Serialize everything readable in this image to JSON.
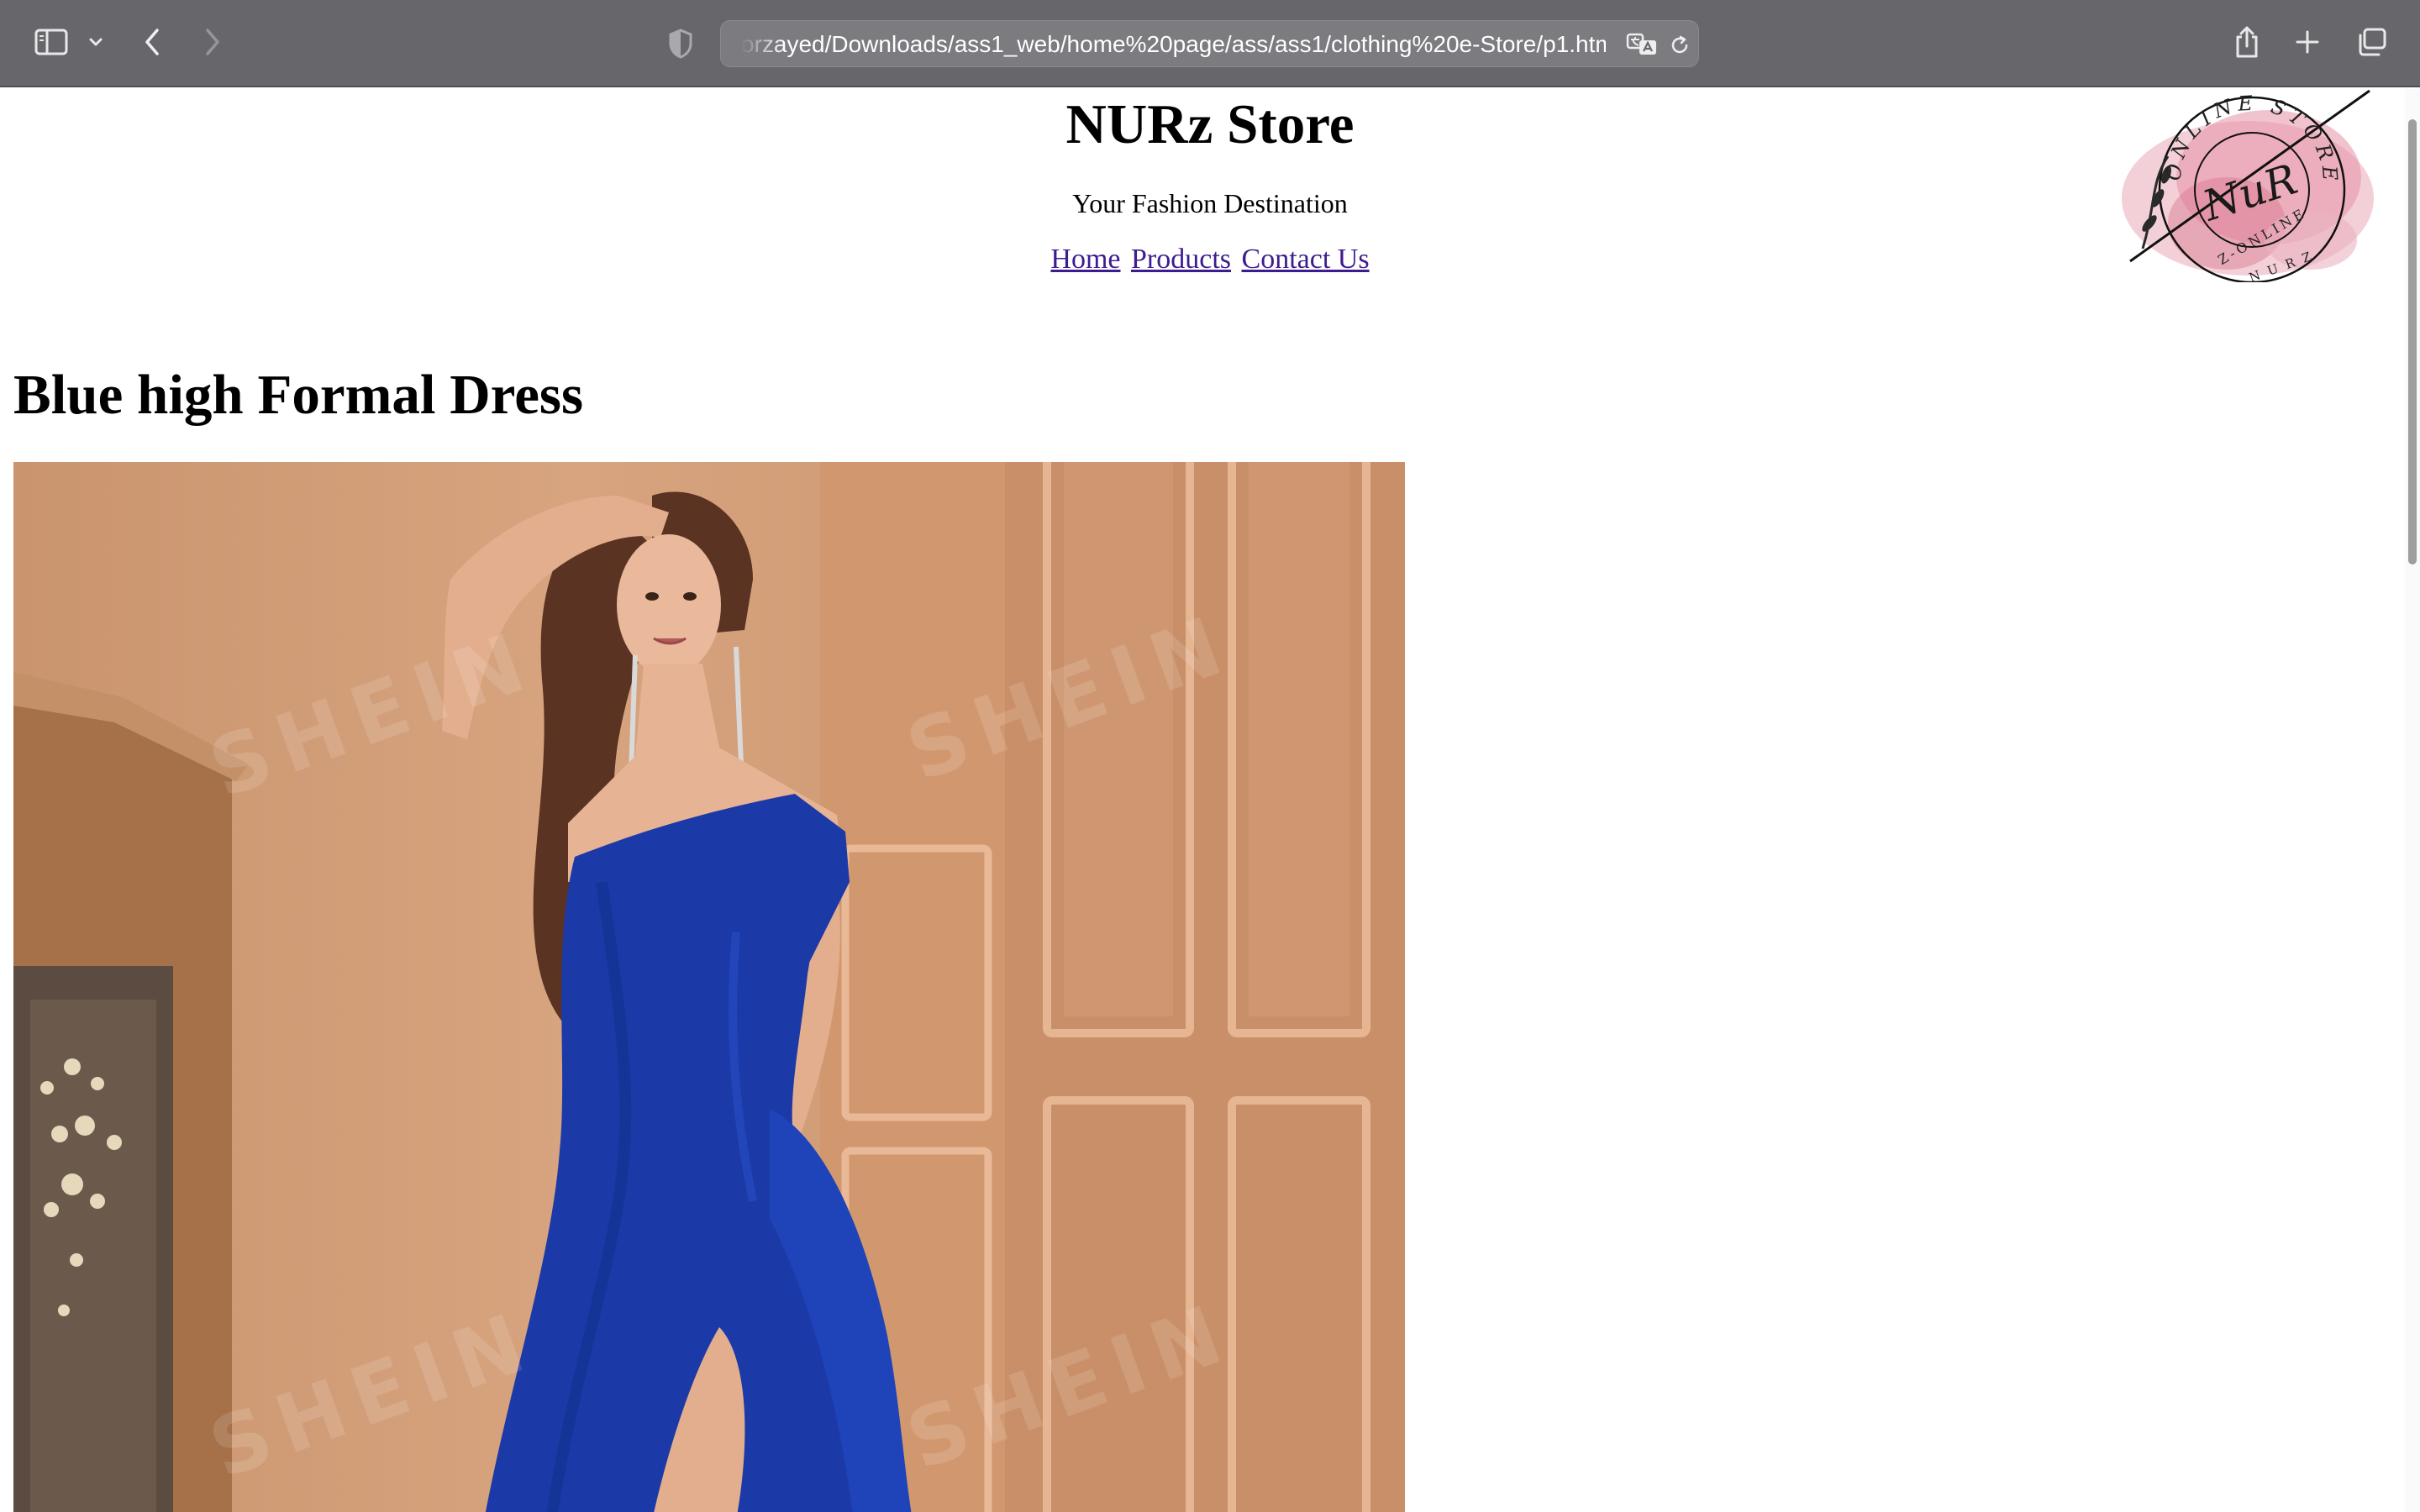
{
  "browser": {
    "url": "orzayed/Downloads/ass1_web/home%20page/ass/ass1/clothing%20e-Store/p1.html"
  },
  "site": {
    "title": "NURz Store",
    "tagline": "Your Fashion Destination",
    "nav": [
      "Home",
      "Products",
      "Contact Us"
    ]
  },
  "logo": {
    "monogram": "NuR",
    "ring_text": "ONLINE STORE",
    "inner_text": "Z-ONLINE",
    "bottom_text": "NURZ"
  },
  "product": {
    "title": "Blue high Formal Dress",
    "image_watermark": "SHEIN",
    "dress_color": "#1b3aa8"
  }
}
